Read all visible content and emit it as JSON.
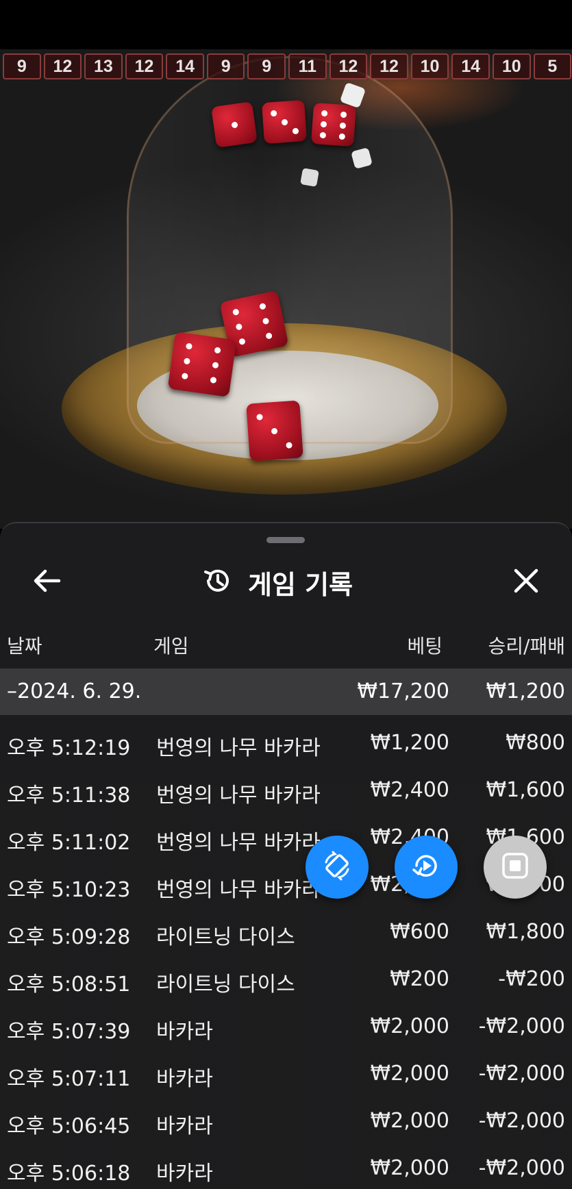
{
  "results_strip": [
    "9",
    "12",
    "13",
    "12",
    "14",
    "9",
    "9",
    "11",
    "12",
    "12",
    "10",
    "14",
    "10",
    "5"
  ],
  "sheet": {
    "title": "게임 기록",
    "icons": {
      "back": "arrow-left-icon",
      "history": "history-icon",
      "close": "close-icon"
    },
    "columns": {
      "date": "날짜",
      "game": "게임",
      "bet": "베팅",
      "result": "승리/패배"
    },
    "date_group": {
      "label": "–2024. 6. 29.",
      "bet_total": "₩17,200",
      "result_total": "₩1,200"
    },
    "rows": [
      {
        "time": "오후 5:12:19",
        "game": "번영의 나무 바카라",
        "bet": "₩1,200",
        "result": "₩800"
      },
      {
        "time": "오후 5:11:38",
        "game": "번영의 나무 바카라",
        "bet": "₩2,400",
        "result": "₩1,600"
      },
      {
        "time": "오후 5:11:02",
        "game": "번영의 나무 바카라",
        "bet": "₩2,400",
        "result": "₩1,600"
      },
      {
        "time": "오후 5:10:23",
        "game": "번영의 나무 바카라",
        "bet": "₩2,400",
        "result": "₩1,600"
      },
      {
        "time": "오후 5:09:28",
        "game": "라이트닝 다이스",
        "bet": "₩600",
        "result": "₩1,800"
      },
      {
        "time": "오후 5:08:51",
        "game": "라이트닝 다이스",
        "bet": "₩200",
        "result": "-₩200"
      },
      {
        "time": "오후 5:07:39",
        "game": "바카라",
        "bet": "₩2,000",
        "result": "-₩2,000"
      },
      {
        "time": "오후 5:07:11",
        "game": "바카라",
        "bet": "₩2,000",
        "result": "-₩2,000"
      },
      {
        "time": "오후 5:06:45",
        "game": "바카라",
        "bet": "₩2,000",
        "result": "-₩2,000"
      },
      {
        "time": "오후 5:06:18",
        "game": "바카라",
        "bet": "₩2,000",
        "result": "-₩2,000"
      }
    ]
  },
  "floating_buttons": [
    {
      "icon": "rotate-screen-icon",
      "color": "#1a8cff"
    },
    {
      "icon": "replay-icon",
      "color": "#1a8cff"
    },
    {
      "icon": "stop-icon",
      "color": "#c9c9c9"
    }
  ],
  "colors": {
    "sheet_bg": "#1c1c1e",
    "date_row_bg": "#3a3a3c",
    "accent_blue": "#1a8cff",
    "dice_red": "#c2142a"
  }
}
